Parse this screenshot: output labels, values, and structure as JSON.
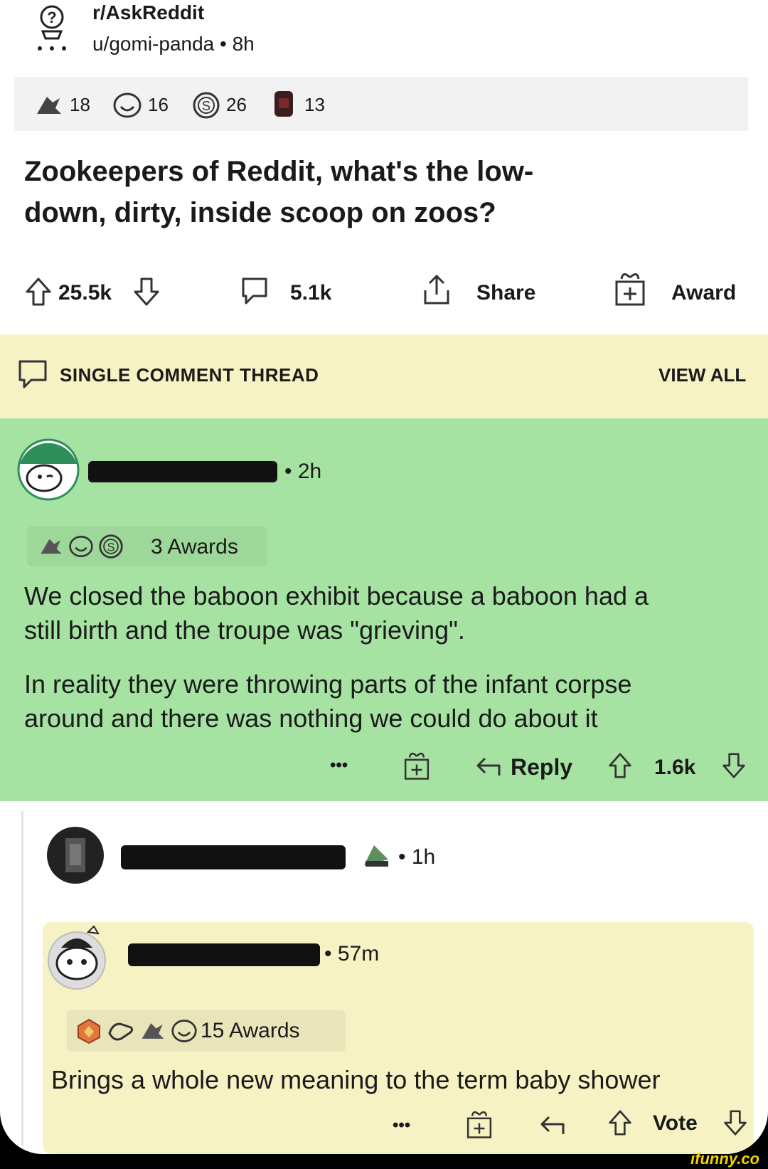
{
  "post": {
    "subreddit": "r/AskReddit",
    "author": "u/gomi-panda",
    "age": "8h",
    "awards": [
      {
        "icon": "rocket-like-award-icon",
        "count": "18"
      },
      {
        "icon": "wholesome-face-award-icon",
        "count": "16"
      },
      {
        "icon": "silver-coin-award-icon",
        "count": "26"
      },
      {
        "icon": "dark-award-icon",
        "count": "13"
      }
    ],
    "title_line1": "Zookeepers of Reddit, what's the low-",
    "title_line2": "down, dirty, inside scoop on zoos?",
    "upvotes": "25.5k",
    "comments": "5.1k",
    "share_label": "Share",
    "award_label": "Award"
  },
  "thread": {
    "label": "SINGLE COMMENT THREAD",
    "view_all": "VIEW ALL"
  },
  "comment1": {
    "age_suffix": "• 2h",
    "awards_label": "3 Awards",
    "para1_line1": "We closed the baboon exhibit because a baboon had a",
    "para1_line2": "still birth and the troupe was \"grieving\".",
    "para2_line1": "In reality they were throwing parts of the infant corpse",
    "para2_line2": "around and there was nothing we could do about it",
    "more": "•••",
    "reply_label": "Reply",
    "score": "1.6k"
  },
  "comment2": {
    "age_suffix": "• 1h"
  },
  "comment3": {
    "age_suffix": "• 57m",
    "awards_label": "15 Awards",
    "text": "Brings a whole new meaning to the term baby shower",
    "more": "•••",
    "vote_label": "Vote"
  },
  "watermark": "ifunny.co",
  "colors": {
    "comment_highlight": "#a6e3a2",
    "thread_bar": "#f6f2c4"
  }
}
